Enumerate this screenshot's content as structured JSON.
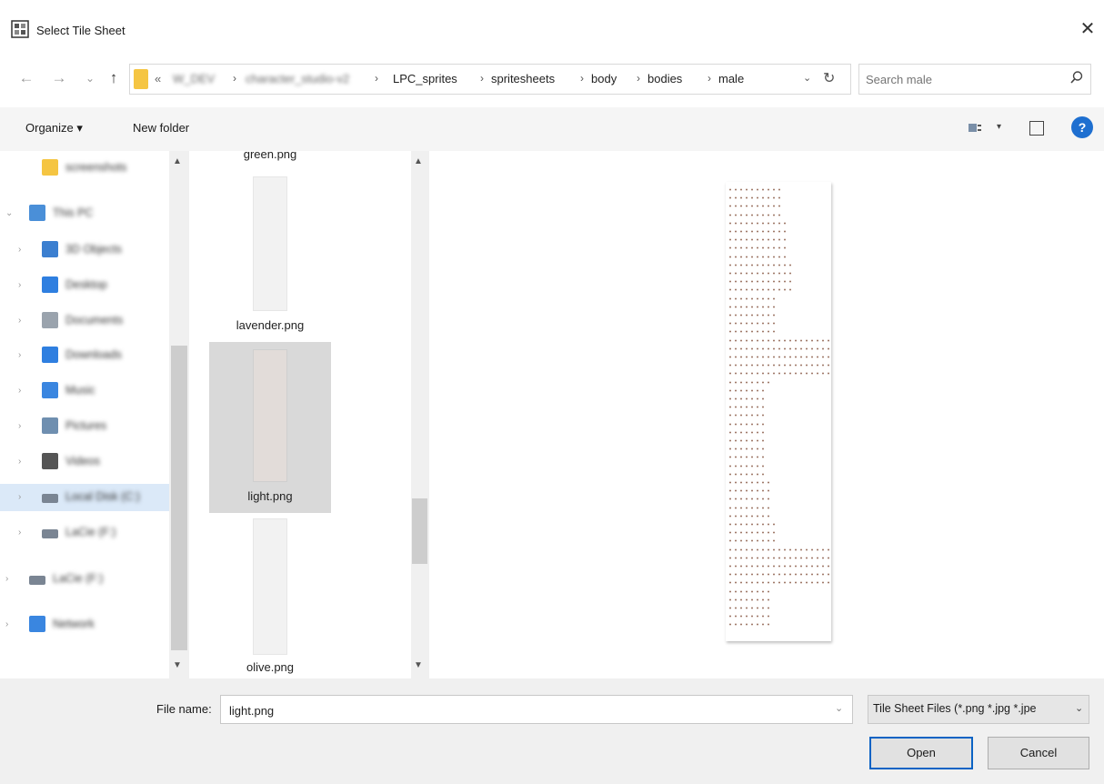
{
  "window": {
    "title": "Select Tile Sheet",
    "close_glyph": "✕"
  },
  "nav": {
    "back_glyph": "←",
    "forward_glyph": "→",
    "recent_glyph": "⌄",
    "up_glyph": "↑",
    "address": {
      "overflow": "«",
      "crumbs": [
        {
          "label": "W_DEV",
          "blurred": true
        },
        {
          "label": "character_studio-v2",
          "blurred": true
        },
        {
          "label": "LPC_sprites",
          "blurred": false
        },
        {
          "label": "spritesheets",
          "blurred": false
        },
        {
          "label": "body",
          "blurred": false
        },
        {
          "label": "bodies",
          "blurred": false
        },
        {
          "label": "male",
          "blurred": false
        }
      ],
      "separator": "›",
      "dropdown_glyph": "⌄",
      "refresh_glyph": "↻"
    },
    "search": {
      "placeholder": "Search male",
      "icon": "search-icon"
    }
  },
  "toolbar": {
    "organize_label": "Organize ▾",
    "new_folder_label": "New folder",
    "view_dropdown_glyph": "▾",
    "help_glyph": "?"
  },
  "nav_pane": {
    "items": [
      {
        "label": "screenshots",
        "icon": "folder-icon"
      },
      {
        "label": "This PC",
        "icon": "computer-icon"
      },
      {
        "label": "3D Objects",
        "icon": "cube-icon"
      },
      {
        "label": "Desktop",
        "icon": "desktop-icon"
      },
      {
        "label": "Documents",
        "icon": "documents-icon"
      },
      {
        "label": "Downloads",
        "icon": "download-icon"
      },
      {
        "label": "Music",
        "icon": "music-icon"
      },
      {
        "label": "Pictures",
        "icon": "pictures-icon"
      },
      {
        "label": "Videos",
        "icon": "videos-icon"
      },
      {
        "label": "Local Disk (C:)",
        "icon": "drive-icon"
      },
      {
        "label": "LaCie (F:)",
        "icon": "drive-icon"
      },
      {
        "label": "LaCie (F:)",
        "icon": "drive-icon"
      },
      {
        "label": "Network",
        "icon": "network-icon"
      }
    ],
    "selected_index": 9
  },
  "files": [
    {
      "name": "green.png"
    },
    {
      "name": "lavender.png"
    },
    {
      "name": "light.png",
      "selected": true
    },
    {
      "name": "olive.png"
    }
  ],
  "bottom": {
    "file_name_label": "File name:",
    "file_name_value": "light.png",
    "file_type_label": "Tile Sheet Files (*.png *.jpg *.jpe",
    "dropdown_glyph": "⌄",
    "open_label": "Open",
    "cancel_label": "Cancel"
  },
  "colors": {
    "accent": "#0b63c4",
    "selection": "#d9d9d9",
    "nav_selection": "#dbe9f8",
    "help": "#1e6fd0"
  }
}
